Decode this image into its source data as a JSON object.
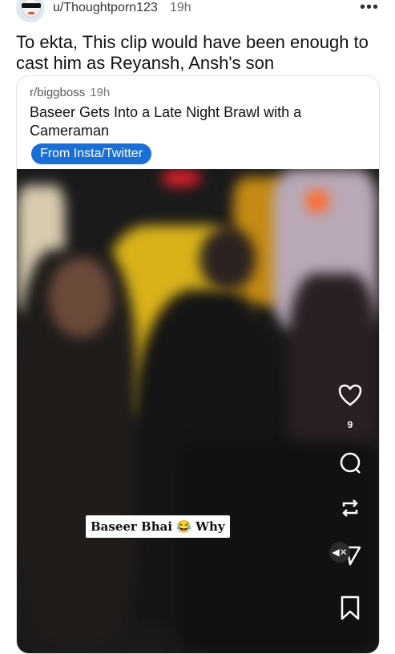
{
  "post": {
    "username": "u/Thoughtporn123",
    "time": "19h",
    "more_icon": "more-dots-icon",
    "title": "To ekta, This clip would have been enough to cast him as Reyansh, Ansh's son"
  },
  "crosspost": {
    "subreddit": "r/biggboss",
    "time": "19h",
    "title": "Baseer Gets Into a Late Night Brawl with a Cameraman",
    "flair": "From Insta/Twitter"
  },
  "video": {
    "caption": "Baseer Bhai 😂 Why",
    "like_count": "9",
    "icons": [
      "heart-icon",
      "comment-icon",
      "repost-icon",
      "share-icon",
      "bookmark-icon",
      "mute-icon"
    ]
  }
}
